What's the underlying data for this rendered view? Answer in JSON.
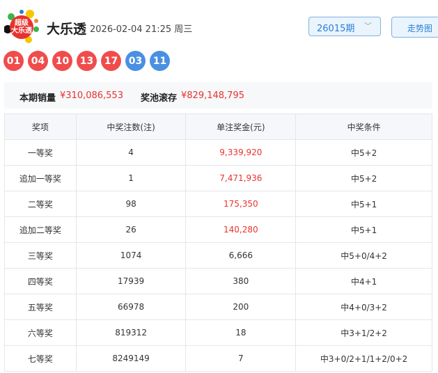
{
  "header": {
    "logo_text": "超级大乐透",
    "title": "大乐透",
    "datetime": "2026-02-04 21:25 周三",
    "issue_select": "26015期",
    "trend_button": "走势图"
  },
  "balls": {
    "front": [
      "01",
      "04",
      "10",
      "13",
      "17"
    ],
    "back": [
      "03",
      "11"
    ]
  },
  "colors": {
    "front": "#f04c4c",
    "back": "#4a90e2",
    "accent": "#e8322f"
  },
  "summary": {
    "sales_label": "本期销量",
    "sales_value": "¥310,086,553",
    "pool_label": "奖池滚存",
    "pool_value": "¥829,148,795"
  },
  "table": {
    "headers": [
      "奖项",
      "中奖注数(注)",
      "单注奖金(元)",
      "中奖条件"
    ],
    "rows": [
      [
        "一等奖",
        "4",
        "9,339,920",
        "中5+2"
      ],
      [
        "追加一等奖",
        "1",
        "7,471,936",
        "中5+2"
      ],
      [
        "二等奖",
        "98",
        "175,350",
        "中5+1"
      ],
      [
        "追加二等奖",
        "26",
        "140,280",
        "中5+1"
      ],
      [
        "三等奖",
        "1074",
        "6,666",
        "中5+0/4+2"
      ],
      [
        "四等奖",
        "17939",
        "380",
        "中4+1"
      ],
      [
        "五等奖",
        "66978",
        "200",
        "中4+0/3+2"
      ],
      [
        "六等奖",
        "819312",
        "18",
        "中3+1/2+2"
      ],
      [
        "七等奖",
        "8249149",
        "7",
        "中3+0/2+1/1+2/0+2"
      ]
    ],
    "red_rows": 4
  }
}
